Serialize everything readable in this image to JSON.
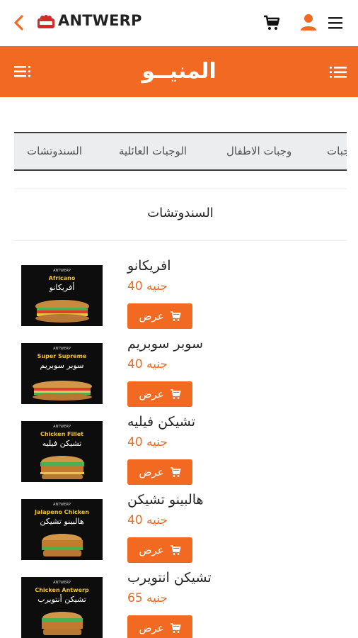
{
  "topbar": {
    "brand": "ANTWERP"
  },
  "header": {
    "title": "المنيــو"
  },
  "tabs": [
    "السندوتشات",
    "الوجبات العائلية",
    "وجبات الاطفال",
    "وجبات"
  ],
  "section": {
    "title": "السندوتشات"
  },
  "colors": {
    "accent": "#f26a21",
    "tab_bg": "#ebedef"
  },
  "items": [
    {
      "name": "افريكانو",
      "price": "جنيه 40",
      "button": "عرض",
      "thumb_en": "Africano",
      "thumb_ar": "أفريكانو"
    },
    {
      "name": "سوبر سوبريم",
      "price": "جنيه 40",
      "button": "عرض",
      "thumb_en": "Super Supreme",
      "thumb_ar": "سوبر سوبريم"
    },
    {
      "name": "تشيكن فيليه",
      "price": "جنيه 40",
      "button": "عرض",
      "thumb_en": "Chicken Fillet",
      "thumb_ar": "تشيكن فيليه"
    },
    {
      "name": "هالبينو تشيكن",
      "price": "جنيه 40",
      "button": "عرض",
      "thumb_en": "Jalapeno Chicken",
      "thumb_ar": "هالبينو تشيكن"
    },
    {
      "name": "تشيكن انتويرب",
      "price": "جنيه 65",
      "button": "عرض",
      "thumb_en": "Chicken Antwerp",
      "thumb_ar": "تشيكن أنتويرب"
    }
  ]
}
